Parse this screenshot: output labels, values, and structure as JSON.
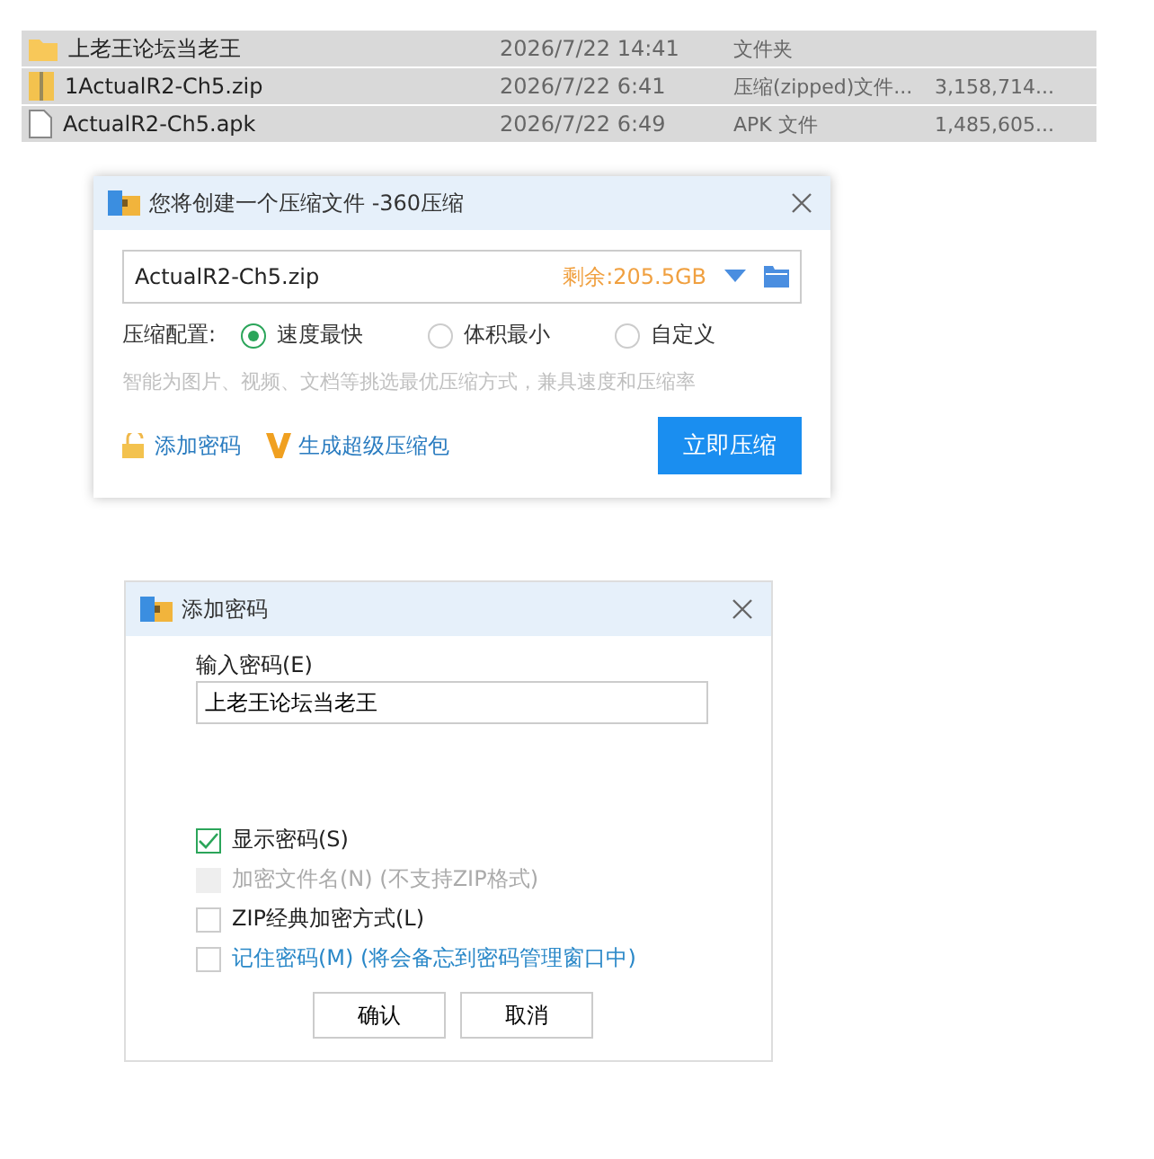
{
  "files": [
    {
      "kind": "folder",
      "name": "上老王论坛当老王",
      "date": "2026/7/22 14:41",
      "type": "文件夹",
      "selected": true
    },
    {
      "kind": "zip",
      "name": "1ActualR2-Ch5.zip",
      "date": "2026/7/22 6:41",
      "type": "压缩(zipped)文件...",
      "size": "3,158,714...",
      "selected": true
    },
    {
      "kind": "file",
      "name": "ActualR2-Ch5.apk",
      "date": "2026/7/22 6:49",
      "type": "APK 文件",
      "size": "1,485,605...",
      "selected": true
    }
  ],
  "compress_dialog": {
    "title": "您将创建一个压缩文件 -360压缩",
    "filename": "ActualR2-Ch5.zip",
    "free_space": "剩余:205.5GB",
    "config_label": "压缩配置:",
    "options": [
      {
        "label": "速度最快",
        "selected": true
      },
      {
        "label": "体积最小",
        "selected": false
      },
      {
        "label": "自定义",
        "selected": false
      }
    ],
    "hint": "智能为图片、视频、文档等挑选最优压缩方式，兼具速度和压缩率",
    "add_password": "添加密码",
    "super_package": "生成超级压缩包",
    "compress_button": "立即压缩"
  },
  "password_dialog": {
    "title": "添加密码",
    "field_label": "输入密码(E)",
    "password": "上老王论坛当老王",
    "checkboxes": [
      {
        "kind": "plain",
        "label": "显示密码(S)",
        "checked": true,
        "disabled": false
      },
      {
        "kind": "plain",
        "label": "加密文件名(N) (不支持ZIP格式)",
        "checked": false,
        "disabled": true
      },
      {
        "kind": "plain",
        "label": "ZIP经典加密方式(L)",
        "checked": false,
        "disabled": false
      },
      {
        "kind": "link",
        "label": "记住密码(M) (将会备忘到密码管理窗口中)",
        "checked": false,
        "disabled": false
      }
    ],
    "buttons": [
      "确认",
      "取消"
    ]
  }
}
